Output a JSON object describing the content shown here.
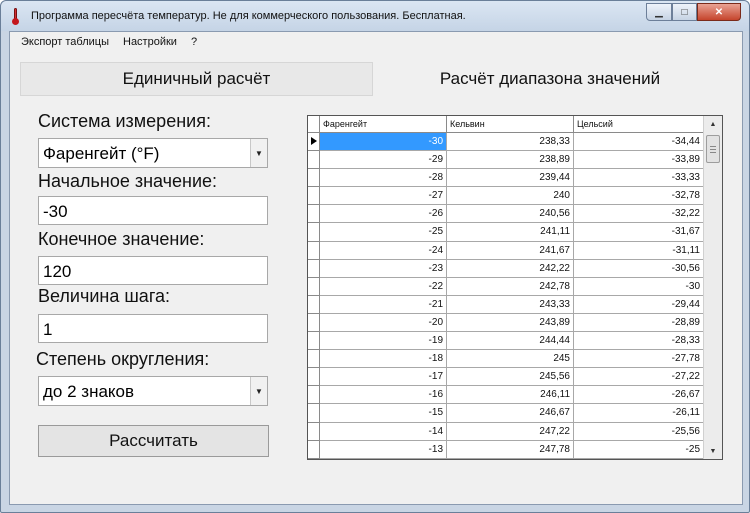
{
  "window": {
    "title": "Программа пересчёта температур. Не для коммерческого пользования. Бесплатная."
  },
  "menu": [
    "Экспорт таблицы",
    "Настройки",
    "?"
  ],
  "tabs": {
    "single": "Единичный расчёт",
    "range": "Расчёт диапазона значений"
  },
  "form": {
    "system_label": "Система измерения:",
    "system_value": "Фаренгейт (°F)",
    "start_label": "Начальное значение:",
    "start_value": "-30",
    "end_label": "Конечное значение:",
    "end_value": "120",
    "step_label": "Величина шага:",
    "step_value": "1",
    "rounding_label": "Степень округления:",
    "rounding_value": "до 2 знаков",
    "calc_button": "Рассчитать"
  },
  "table": {
    "columns": [
      "Фаренгейт",
      "Кельвин",
      "Цельсий"
    ],
    "rows": [
      [
        "-30",
        "238,33",
        "-34,44"
      ],
      [
        "-29",
        "238,89",
        "-33,89"
      ],
      [
        "-28",
        "239,44",
        "-33,33"
      ],
      [
        "-27",
        "240",
        "-32,78"
      ],
      [
        "-26",
        "240,56",
        "-32,22"
      ],
      [
        "-25",
        "241,11",
        "-31,67"
      ],
      [
        "-24",
        "241,67",
        "-31,11"
      ],
      [
        "-23",
        "242,22",
        "-30,56"
      ],
      [
        "-22",
        "242,78",
        "-30"
      ],
      [
        "-21",
        "243,33",
        "-29,44"
      ],
      [
        "-20",
        "243,89",
        "-28,89"
      ],
      [
        "-19",
        "244,44",
        "-28,33"
      ],
      [
        "-18",
        "245",
        "-27,78"
      ],
      [
        "-17",
        "245,56",
        "-27,22"
      ],
      [
        "-16",
        "246,11",
        "-26,67"
      ],
      [
        "-15",
        "246,67",
        "-26,11"
      ],
      [
        "-14",
        "247,22",
        "-25,56"
      ],
      [
        "-13",
        "247,78",
        "-25"
      ]
    ]
  },
  "icons": {
    "app": "thermometer-icon",
    "minimize": "minimize-icon",
    "maximize": "maximize-icon",
    "close": "close-icon",
    "dropdown": "chevron-down-icon",
    "scroll_up": "scroll-up-icon",
    "scroll_down": "scroll-down-icon"
  },
  "colors": {
    "selection": "#3399ff",
    "titlebar": "#c9d5e4",
    "close_button": "#c5442c"
  }
}
